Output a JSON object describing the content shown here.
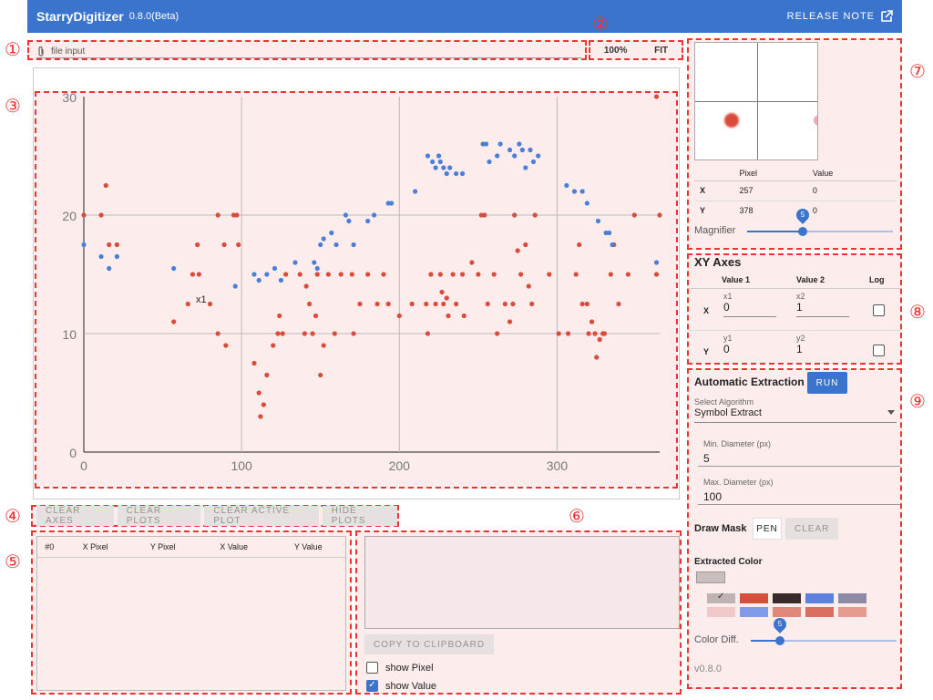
{
  "app": {
    "title": "StarryDigitizer",
    "version": "0.8.0(Beta)",
    "release_note": "RELEASE NOTE"
  },
  "markers": [
    "①",
    "②",
    "③",
    "④",
    "⑤",
    "⑥",
    "⑦",
    "⑧",
    "⑨"
  ],
  "file_input": {
    "placeholder": "file input"
  },
  "zoom": {
    "percent": "100%",
    "fit": "FIT"
  },
  "plot": {
    "axis_label": "x1",
    "y_ticks": [
      "30",
      "20",
      "10",
      "0"
    ],
    "x_ticks": [
      "0",
      "100",
      "200",
      "300"
    ]
  },
  "chart_data": {
    "type": "scatter",
    "title": "",
    "xlabel": "",
    "ylabel": "",
    "xlim": [
      0,
      365
    ],
    "ylim": [
      0,
      30
    ],
    "grid": true,
    "series": [
      {
        "color": "#d94b3a",
        "points": [
          [
            0,
            20
          ],
          [
            11,
            20
          ],
          [
            14,
            22.5
          ],
          [
            16,
            17.5
          ],
          [
            21,
            17.5
          ],
          [
            57,
            11
          ],
          [
            66,
            12.5
          ],
          [
            69,
            15
          ],
          [
            72,
            17.5
          ],
          [
            73,
            15
          ],
          [
            80,
            12.5
          ],
          [
            85,
            20
          ],
          [
            89,
            17.5
          ],
          [
            85,
            10
          ],
          [
            90,
            9
          ],
          [
            95,
            20
          ],
          [
            97,
            20
          ],
          [
            98,
            17.5
          ],
          [
            108,
            7.5
          ],
          [
            111,
            5
          ],
          [
            112,
            3
          ],
          [
            114,
            4
          ],
          [
            116,
            6.5
          ],
          [
            120,
            9
          ],
          [
            123,
            10
          ],
          [
            124,
            11.5
          ],
          [
            126,
            10
          ],
          [
            128,
            15
          ],
          [
            137,
            15
          ],
          [
            140,
            10
          ],
          [
            141,
            14
          ],
          [
            143,
            12.5
          ],
          [
            145,
            10
          ],
          [
            147,
            11.5
          ],
          [
            148,
            15
          ],
          [
            150,
            6.5
          ],
          [
            152,
            9
          ],
          [
            155,
            15
          ],
          [
            159,
            10
          ],
          [
            163,
            15
          ],
          [
            170,
            15
          ],
          [
            171,
            10
          ],
          [
            175,
            12.5
          ],
          [
            180,
            15
          ],
          [
            186,
            12.5
          ],
          [
            190,
            15
          ],
          [
            193,
            12.5
          ],
          [
            200,
            11.5
          ],
          [
            208,
            12.5
          ],
          [
            217,
            12.5
          ],
          [
            218,
            10
          ],
          [
            220,
            15
          ],
          [
            223,
            12.5
          ],
          [
            226,
            15
          ],
          [
            227,
            13.5
          ],
          [
            228,
            12.5
          ],
          [
            230,
            13
          ],
          [
            231,
            11.5
          ],
          [
            234,
            15
          ],
          [
            236,
            12.5
          ],
          [
            240,
            15
          ],
          [
            241,
            11.5
          ],
          [
            246,
            16
          ],
          [
            250,
            15
          ],
          [
            252,
            20
          ],
          [
            254,
            20
          ],
          [
            256,
            12.5
          ],
          [
            260,
            15
          ],
          [
            262,
            10
          ],
          [
            267,
            12.5
          ],
          [
            270,
            11
          ],
          [
            272,
            12.5
          ],
          [
            273,
            20
          ],
          [
            275,
            17
          ],
          [
            277,
            15
          ],
          [
            280,
            17.5
          ],
          [
            282,
            14
          ],
          [
            284,
            12.5
          ],
          [
            286,
            20
          ],
          [
            295,
            15
          ],
          [
            301,
            10
          ],
          [
            307,
            10
          ],
          [
            312,
            15
          ],
          [
            314,
            17.5
          ],
          [
            316,
            12.5
          ],
          [
            319,
            12.5
          ],
          [
            320,
            10
          ],
          [
            322,
            11
          ],
          [
            324,
            10
          ],
          [
            325,
            8
          ],
          [
            327,
            9.5
          ],
          [
            329,
            10
          ],
          [
            330,
            10
          ],
          [
            334,
            15
          ],
          [
            336,
            17.5
          ],
          [
            339,
            12.5
          ],
          [
            345,
            15
          ],
          [
            349,
            20
          ],
          [
            363,
            15
          ],
          [
            365,
            20
          ],
          [
            363,
            30
          ]
        ]
      },
      {
        "color": "#4a7fd8",
        "points": [
          [
            0,
            17.5
          ],
          [
            11,
            16.5
          ],
          [
            16,
            15.5
          ],
          [
            21,
            16.5
          ],
          [
            57,
            15.5
          ],
          [
            96,
            14
          ],
          [
            108,
            15
          ],
          [
            111,
            14.5
          ],
          [
            116,
            15
          ],
          [
            121,
            15.5
          ],
          [
            125,
            14.5
          ],
          [
            134,
            16
          ],
          [
            146,
            16
          ],
          [
            148,
            15.5
          ],
          [
            150,
            17.5
          ],
          [
            152,
            18
          ],
          [
            157,
            18.5
          ],
          [
            160,
            17.5
          ],
          [
            166,
            20
          ],
          [
            168,
            19.5
          ],
          [
            171,
            17.5
          ],
          [
            180,
            19.5
          ],
          [
            184,
            20
          ],
          [
            193,
            21
          ],
          [
            195,
            21
          ],
          [
            210,
            22
          ],
          [
            218,
            25
          ],
          [
            221,
            24.5
          ],
          [
            223,
            24
          ],
          [
            225,
            25
          ],
          [
            226,
            24.5
          ],
          [
            228,
            24
          ],
          [
            230,
            23.5
          ],
          [
            232,
            24
          ],
          [
            236,
            23.5
          ],
          [
            240,
            23.5
          ],
          [
            253,
            26
          ],
          [
            255,
            26
          ],
          [
            257,
            24.5
          ],
          [
            262,
            25
          ],
          [
            264,
            26
          ],
          [
            270,
            25.5
          ],
          [
            273,
            25
          ],
          [
            276,
            26
          ],
          [
            278,
            25.5
          ],
          [
            280,
            24
          ],
          [
            283,
            25.5
          ],
          [
            285,
            24.5
          ],
          [
            288,
            25
          ],
          [
            306,
            22.5
          ],
          [
            311,
            22
          ],
          [
            316,
            22
          ],
          [
            319,
            21
          ],
          [
            326,
            19.5
          ],
          [
            331,
            18.5
          ],
          [
            333,
            18.5
          ],
          [
            335,
            17.5
          ],
          [
            363,
            16
          ]
        ]
      }
    ]
  },
  "toolbar": {
    "clear_axes": "CLEAR AXES",
    "clear_plots": "CLEAR PLOTS",
    "clear_active": "CLEAR ACTIVE PLOT",
    "hide_plots": "HIDE PLOTS"
  },
  "table": {
    "headers": [
      "#0",
      "X Pixel",
      "Y Pixel",
      "X Value",
      "Y Value"
    ]
  },
  "export": {
    "copy": "COPY TO CLIPBOARD",
    "show_pixel": "show Pixel",
    "show_value": "show Value"
  },
  "magnifier": {
    "col_pixel": "Pixel",
    "col_value": "Value",
    "row_x": "X",
    "row_y": "Y",
    "x_pixel": "257",
    "x_value": "0",
    "y_pixel": "378",
    "y_value": "0",
    "label": "Magnifier",
    "slider_value": "5",
    "slider_fraction": 0.38
  },
  "axes": {
    "title": "XY Axes",
    "col_v1": "Value 1",
    "col_v2": "Value 2",
    "col_log": "Log",
    "x_label": "X",
    "y_label": "Y",
    "x1_label": "x1",
    "x1": "0",
    "x2_label": "x2",
    "x2": "1",
    "y1_label": "y1",
    "y1": "0",
    "y2_label": "y2",
    "y2": "1"
  },
  "extraction": {
    "title": "Automatic Extraction",
    "run": "RUN",
    "algo_label": "Select Algorithm",
    "algo": "Symbol Extract",
    "min_label": "Min. Diameter (px)",
    "min": "5",
    "max_label": "Max. Diameter (px)",
    "max": "100",
    "mask_label": "Draw Mask",
    "pen": "PEN",
    "clear": "CLEAR",
    "color_title": "Extracted Color",
    "color_diff": "Color Diff.",
    "color_diff_value": "5",
    "color_diff_fraction": 0.2,
    "version": "v0.8.0",
    "selected_color": "#c9bdbd",
    "palette": [
      "#bdb3b3",
      "#d4503c",
      "#3b2a2a",
      "#5e80de",
      "#8d8aa6",
      "#f0c8c8",
      "#7f9be8",
      "#e0877a",
      "#d9705f",
      "#e59a8e"
    ]
  }
}
